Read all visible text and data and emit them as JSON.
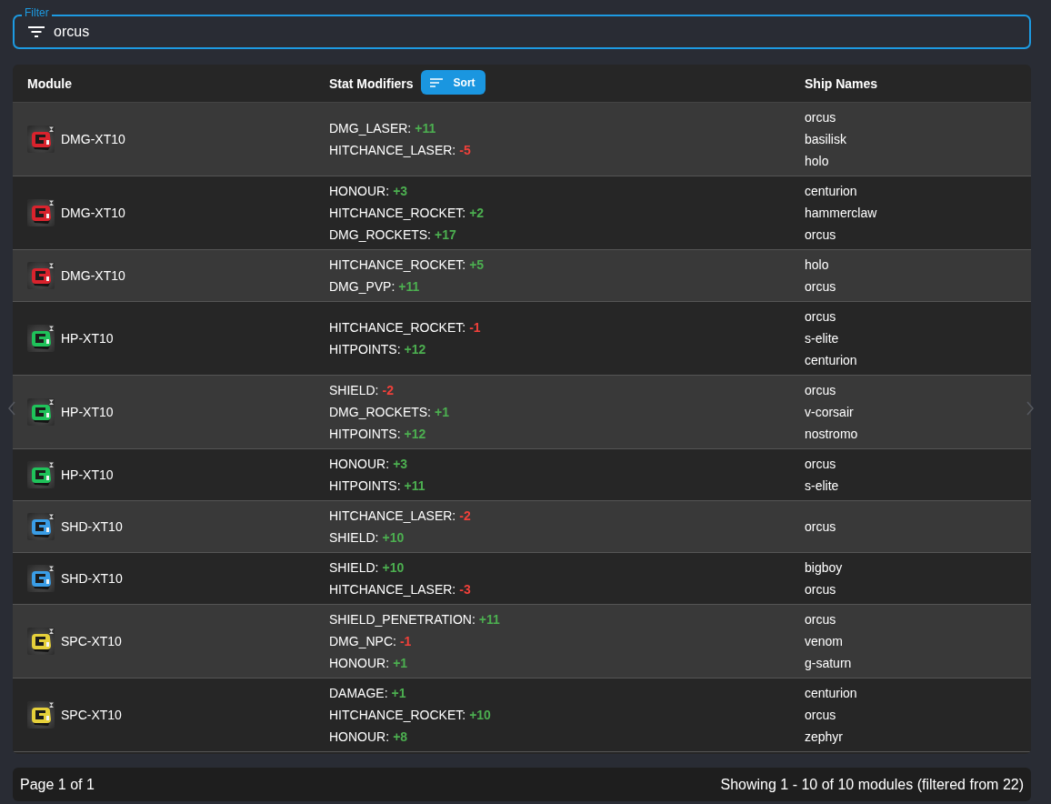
{
  "filter": {
    "label": "Filter",
    "value": "orcus"
  },
  "table": {
    "columns": [
      {
        "label": "Module"
      },
      {
        "label": "Stat Modifiers",
        "sort_button": "Sort"
      },
      {
        "label": "Ship Names"
      }
    ],
    "rows": [
      {
        "module": "DMG-XT10",
        "color": "#d9232d",
        "modifiers": [
          {
            "stat": "DMG_LASER:",
            "value": "+11",
            "kind": "bonus"
          },
          {
            "stat": "HITCHANCE_LASER:",
            "value": "-5",
            "kind": "penalty"
          }
        ],
        "ships": [
          "orcus",
          "basilisk",
          "holo"
        ]
      },
      {
        "module": "DMG-XT10",
        "color": "#d9232d",
        "modifiers": [
          {
            "stat": "HONOUR:",
            "value": "+3",
            "kind": "bonus"
          },
          {
            "stat": "HITCHANCE_ROCKET:",
            "value": "+2",
            "kind": "bonus"
          },
          {
            "stat": "DMG_ROCKETS:",
            "value": "+17",
            "kind": "bonus"
          }
        ],
        "ships": [
          "centurion",
          "hammerclaw",
          "orcus"
        ]
      },
      {
        "module": "DMG-XT10",
        "color": "#d9232d",
        "modifiers": [
          {
            "stat": "HITCHANCE_ROCKET:",
            "value": "+5",
            "kind": "bonus"
          },
          {
            "stat": "DMG_PVP:",
            "value": "+11",
            "kind": "bonus"
          }
        ],
        "ships": [
          "holo",
          "orcus"
        ]
      },
      {
        "module": "HP-XT10",
        "color": "#1fc25a",
        "modifiers": [
          {
            "stat": "HITCHANCE_ROCKET:",
            "value": "-1",
            "kind": "penalty"
          },
          {
            "stat": "HITPOINTS:",
            "value": "+12",
            "kind": "bonus"
          }
        ],
        "ships": [
          "orcus",
          "s-elite",
          "centurion"
        ]
      },
      {
        "module": "HP-XT10",
        "color": "#1fc25a",
        "modifiers": [
          {
            "stat": "SHIELD:",
            "value": "-2",
            "kind": "penalty"
          },
          {
            "stat": "DMG_ROCKETS:",
            "value": "+1",
            "kind": "bonus"
          },
          {
            "stat": "HITPOINTS:",
            "value": "+12",
            "kind": "bonus"
          }
        ],
        "ships": [
          "orcus",
          "v-corsair",
          "nostromo"
        ]
      },
      {
        "module": "HP-XT10",
        "color": "#1fc25a",
        "modifiers": [
          {
            "stat": "HONOUR:",
            "value": "+3",
            "kind": "bonus"
          },
          {
            "stat": "HITPOINTS:",
            "value": "+11",
            "kind": "bonus"
          }
        ],
        "ships": [
          "orcus",
          "s-elite"
        ]
      },
      {
        "module": "SHD-XT10",
        "color": "#3a9de6",
        "modifiers": [
          {
            "stat": "HITCHANCE_LASER:",
            "value": "-2",
            "kind": "penalty"
          },
          {
            "stat": "SHIELD:",
            "value": "+10",
            "kind": "bonus"
          }
        ],
        "ships": [
          "orcus"
        ]
      },
      {
        "module": "SHD-XT10",
        "color": "#3a9de6",
        "modifiers": [
          {
            "stat": "SHIELD:",
            "value": "+10",
            "kind": "bonus"
          },
          {
            "stat": "HITCHANCE_LASER:",
            "value": "-3",
            "kind": "penalty"
          }
        ],
        "ships": [
          "bigboy",
          "orcus"
        ]
      },
      {
        "module": "SPC-XT10",
        "color": "#e6d03a",
        "modifiers": [
          {
            "stat": "SHIELD_PENETRATION:",
            "value": "+11",
            "kind": "bonus"
          },
          {
            "stat": "DMG_NPC:",
            "value": "-1",
            "kind": "penalty"
          },
          {
            "stat": "HONOUR:",
            "value": "+1",
            "kind": "bonus"
          }
        ],
        "ships": [
          "orcus",
          "venom",
          "g-saturn"
        ]
      },
      {
        "module": "SPC-XT10",
        "color": "#e6d03a",
        "modifiers": [
          {
            "stat": "DAMAGE:",
            "value": "+1",
            "kind": "bonus"
          },
          {
            "stat": "HITCHANCE_ROCKET:",
            "value": "+10",
            "kind": "bonus"
          },
          {
            "stat": "HONOUR:",
            "value": "+8",
            "kind": "bonus"
          }
        ],
        "ships": [
          "centurion",
          "orcus",
          "zephyr"
        ]
      }
    ]
  },
  "footer": {
    "page": "Page 1 of 1",
    "summary": "Showing 1 - 10 of 10 modules (filtered from 22)"
  }
}
